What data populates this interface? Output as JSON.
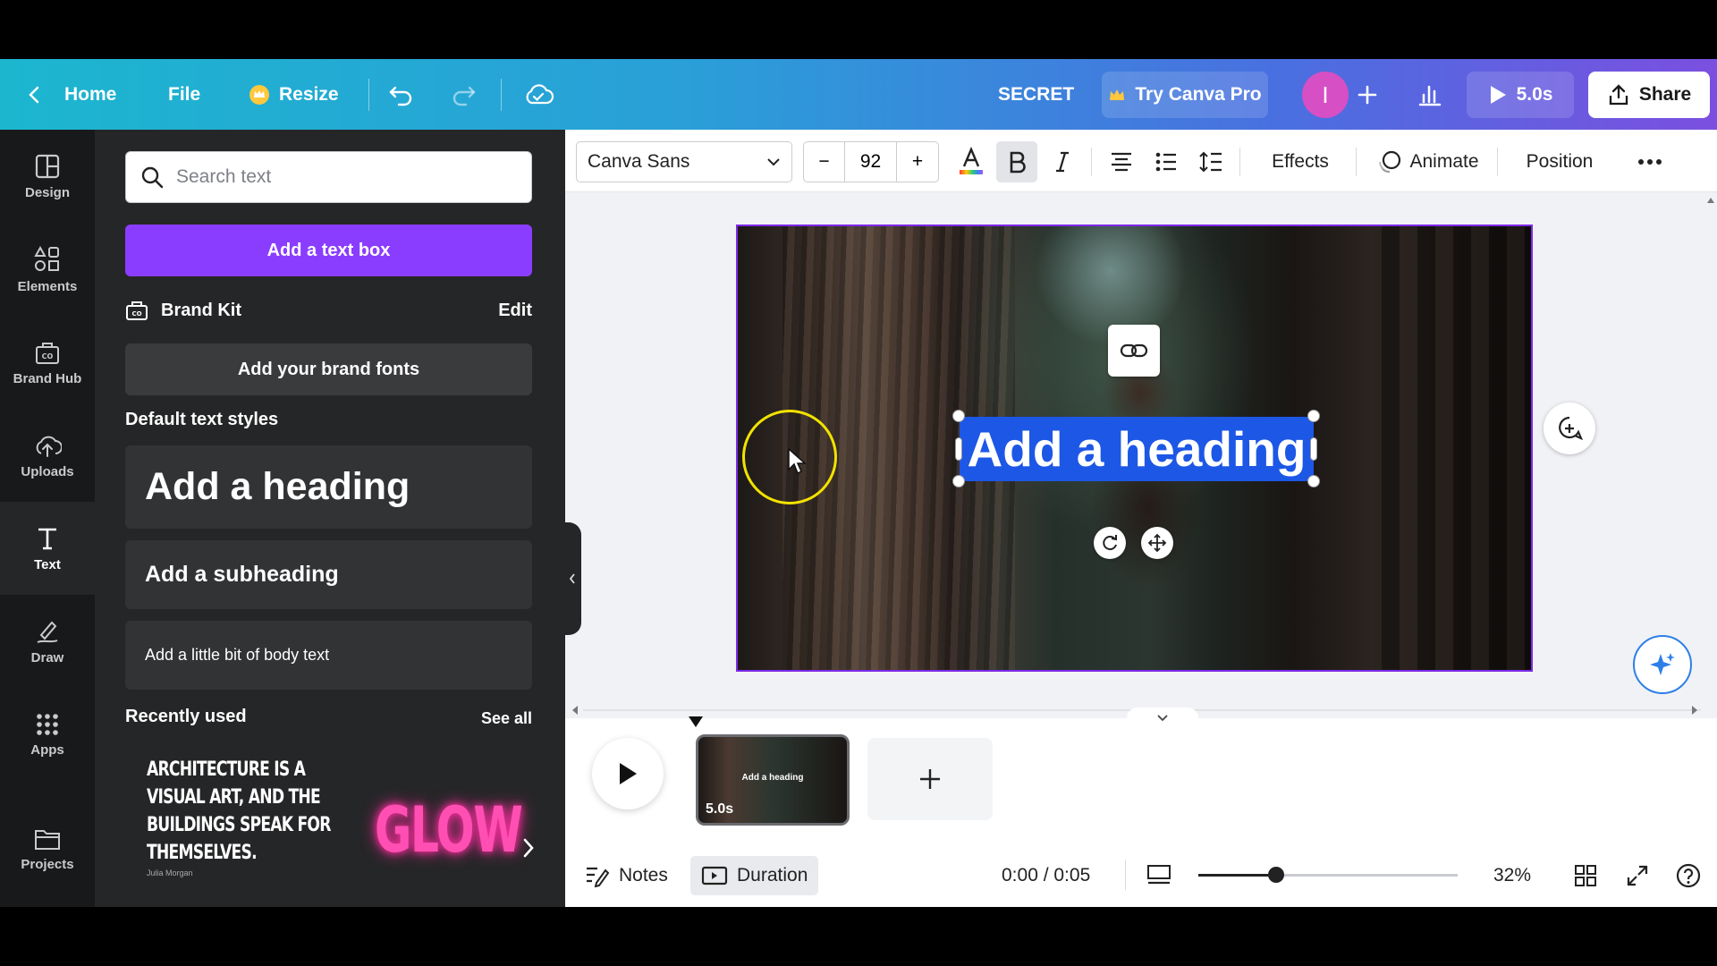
{
  "topbar": {
    "home": "Home",
    "file": "File",
    "resize": "Resize",
    "design_title": "SECRET",
    "try_pro": "Try Canva Pro",
    "avatar_initial": "I",
    "play_duration": "5.0s",
    "share": "Share"
  },
  "rail": {
    "items": [
      {
        "label": "Design",
        "icon": "design-icon"
      },
      {
        "label": "Elements",
        "icon": "elements-icon"
      },
      {
        "label": "Brand Hub",
        "icon": "brand-hub-icon"
      },
      {
        "label": "Uploads",
        "icon": "uploads-icon"
      },
      {
        "label": "Text",
        "icon": "text-icon"
      },
      {
        "label": "Draw",
        "icon": "draw-icon"
      },
      {
        "label": "Apps",
        "icon": "apps-icon"
      },
      {
        "label": "Projects",
        "icon": "projects-icon"
      }
    ],
    "active": "Text"
  },
  "panel": {
    "search_placeholder": "Search text",
    "add_text_box": "Add a text box",
    "brand_kit": "Brand Kit",
    "brand_edit": "Edit",
    "add_brand_fonts": "Add your brand fonts",
    "default_styles_title": "Default text styles",
    "heading": "Add a heading",
    "subheading": "Add a subheading",
    "body": "Add a little bit of body text",
    "recently_used": "Recently used",
    "see_all": "See all",
    "recent_arch_text": "Architecture is a\nvisual art, and the\nbuildings speak for\nthemselves.",
    "recent_arch_author": "Julia Morgan",
    "recent_glow": "GLOW"
  },
  "toolbar": {
    "font": "Canva Sans",
    "size_minus": "−",
    "size": "92",
    "size_plus": "+",
    "effects": "Effects",
    "animate": "Animate",
    "position": "Position"
  },
  "canvas": {
    "heading_text": "Add a heading"
  },
  "timeline": {
    "page_heading": "Add a heading",
    "page_duration": "5.0s",
    "add_page": "+"
  },
  "footer": {
    "notes": "Notes",
    "duration": "Duration",
    "time": "0:00 / 0:05",
    "zoom_percent": "32%",
    "zoom_fraction": 0.3
  },
  "colors": {
    "accent": "#8b3dff",
    "selection": "#1d57e6",
    "canvas_border": "#7d2ae8",
    "cursor_ring": "#f2e200",
    "glow": "#ff4fb3"
  }
}
